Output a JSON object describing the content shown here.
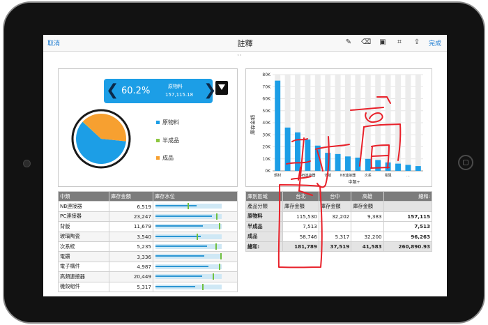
{
  "nav": {
    "cancel": "取消",
    "title": "註釋",
    "done": "完成",
    "tools": [
      "pencil-icon",
      "eraser-icon",
      "text-box-icon",
      "crop-icon",
      "share-icon"
    ]
  },
  "doc_mark": "◦◦",
  "kpi": {
    "prev": "❮",
    "next": "❯",
    "percent": "60.2%",
    "name": "原物料",
    "amount": "157,115.18"
  },
  "pie": {
    "legend": [
      {
        "label": "原物料",
        "color": "#1c9ee6"
      },
      {
        "label": "半成品",
        "color": "#8cc63f"
      },
      {
        "label": "成品",
        "color": "#f7a030"
      }
    ],
    "slices": [
      60.2,
      0.2,
      39.6
    ]
  },
  "bar_chart": {
    "ylabel": "庫存金額",
    "xlabel": "中類+",
    "ytick_labels": [
      "0K",
      "10K",
      "20K",
      "30K",
      "40K",
      "50K",
      "60K",
      "70K",
      "80K"
    ],
    "xtick_labels": [
      "鋼材",
      "NB連接器",
      "背版",
      "NB連接器",
      "次系",
      "電阻",
      "..."
    ],
    "ylim": [
      0,
      80
    ],
    "values": [
      75,
      36,
      32,
      26,
      21,
      15,
      14,
      12,
      11,
      10,
      9,
      7,
      6,
      5,
      4
    ]
  },
  "chart_data": {
    "type": "bar",
    "ylabel": "庫存金額",
    "xlabel": "中類+",
    "ylim": [
      0,
      80
    ],
    "values": [
      75,
      36,
      32,
      26,
      21,
      15,
      14,
      12,
      11,
      10,
      9,
      7,
      6,
      5,
      4
    ]
  },
  "left_table": {
    "headers": [
      "中類",
      "庫存金額",
      "庫存水位"
    ],
    "rows": [
      {
        "name": "NB連接器",
        "value": "6,519",
        "fill": 0.62,
        "mark": 0.48
      },
      {
        "name": "PC連接器",
        "value": "23,247",
        "fill": 0.85,
        "mark": 0.92
      },
      {
        "name": "背版",
        "value": "11,679",
        "fill": 0.72,
        "mark": 0.96
      },
      {
        "name": "玻璃陶瓷",
        "value": "3,540",
        "fill": 0.68,
        "mark": 0.62
      },
      {
        "name": "次系統",
        "value": "5,235",
        "fill": 0.78,
        "mark": 0.9
      },
      {
        "name": "電鑽",
        "value": "3,336",
        "fill": 0.74,
        "mark": 0.98
      },
      {
        "name": "電子構件",
        "value": "4,987",
        "fill": 0.8,
        "mark": 0.96
      },
      {
        "name": "高頻連接器",
        "value": "20,449",
        "fill": 0.7,
        "mark": 0.86
      },
      {
        "name": "機殼組件",
        "value": "5,317",
        "fill": 0.6,
        "mark": 0.7
      }
    ]
  },
  "pivot": {
    "header1": [
      "庫別區域",
      "台北",
      "台中",
      "高雄",
      "總和:"
    ],
    "header2": [
      "產品分類",
      "庫存金額",
      "庫存金額",
      "庫存金額",
      ""
    ],
    "rows": [
      [
        "原物料",
        "115,530",
        "32,202",
        "9,383",
        "157,115"
      ],
      [
        "半成品",
        "7,513",
        "",
        "",
        "7,513"
      ],
      [
        "成品",
        "58,746",
        "5,317",
        "32,200",
        "96,263"
      ],
      [
        "總和:",
        "181,789",
        "37,519",
        "41,583",
        "260,890.93"
      ]
    ]
  },
  "annotation": {
    "color": "#e8212a"
  }
}
